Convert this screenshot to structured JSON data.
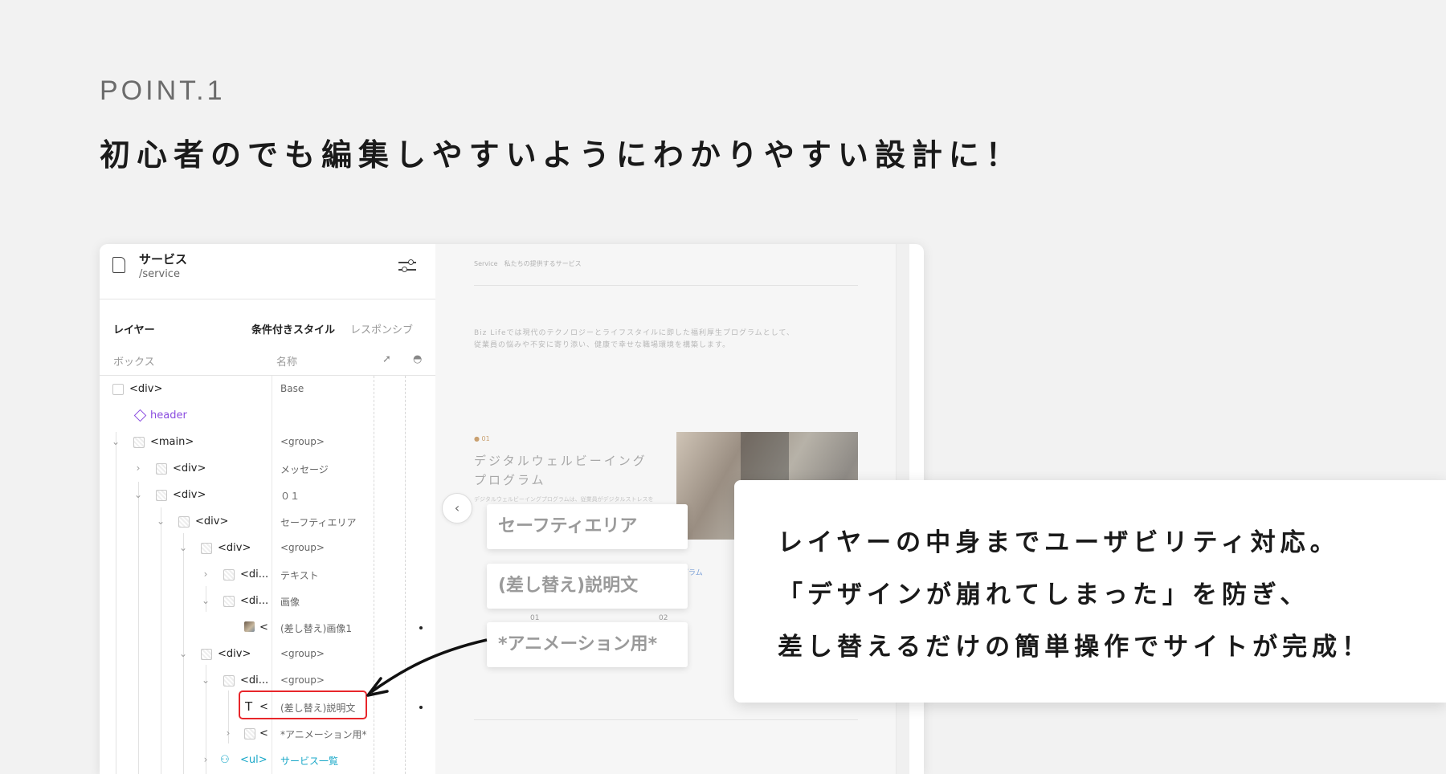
{
  "point_label": "POINT.1",
  "headline": "初心者のでも編集しやすいようにわかりやすい設計に！",
  "page": {
    "title": "サービス",
    "path": "/service"
  },
  "panel": {
    "tabs": {
      "layers": "レイヤー",
      "conditional": "条件付きスタイル",
      "responsive": "レスポンシブ"
    },
    "columns": {
      "box": "ボックス",
      "name": "名称"
    }
  },
  "layers": [
    {
      "label": "<div>",
      "name": "Base"
    },
    {
      "label": "header",
      "name": ""
    },
    {
      "label": "<main>",
      "name": "<group>"
    },
    {
      "label": "<div>",
      "name": "メッセージ"
    },
    {
      "label": "<div>",
      "name": "０１"
    },
    {
      "label": "<div>",
      "name": "セーフティエリア"
    },
    {
      "label": "<div>",
      "name": "<group>"
    },
    {
      "label": "<di...",
      "name": "テキスト"
    },
    {
      "label": "<di...",
      "name": "画像"
    },
    {
      "label": "<",
      "name": "(差し替え)画像1"
    },
    {
      "label": "<div>",
      "name": "<group>"
    },
    {
      "label": "<di...",
      "name": "<group>"
    },
    {
      "label": "<",
      "name": "(差し替え)説明文"
    },
    {
      "label": "<",
      "name": "*アニメーション用*"
    },
    {
      "label": "<ul>",
      "name": "サービス一覧"
    }
  ],
  "preview": {
    "breadcrumb": "Service　私たちの提供するサービス",
    "intro_1": "Biz Lifeでは現代のテクノロジーとライフスタイルに即した福利厚生プログラムとして、",
    "intro_2": "従業員の悩みや不安に寄り添い、健康で幸せな職場環境を構築します。",
    "item_number": "● 01",
    "item_title_1": "デジタルウェルビーイング",
    "item_title_2": "プログラム",
    "item_desc": "デジタルウェルビーイングプログラムは、従業員がデジタルストレスを",
    "link_text": "プログラム",
    "num_01": "01",
    "num_02": "02"
  },
  "callouts": {
    "safety": "セーフティエリア",
    "description": "(差し替え)説明文",
    "animation": "*アニメーション用*"
  },
  "card": {
    "line1": "レイヤーの中身までユーザビリティ対応。",
    "line2": "「デザインが崩れてしまった」を防ぎ、",
    "line3": "差し替えるだけの簡単操作でサイトが完成！"
  },
  "colors": {
    "background": "#f2f2f2",
    "highlight": "#e8262b",
    "purple": "#8b4de0",
    "cyan": "#1aa8c8"
  }
}
